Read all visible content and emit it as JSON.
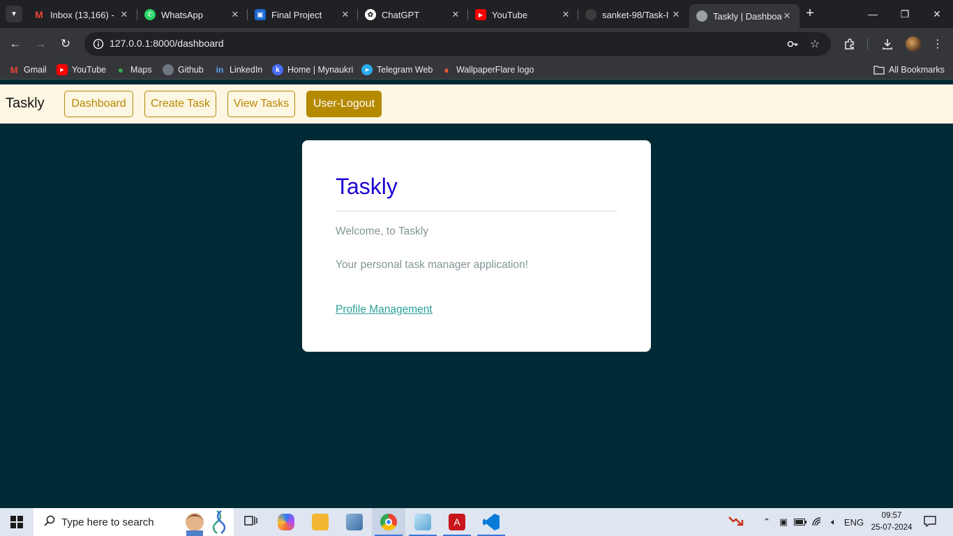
{
  "browser": {
    "tabs": [
      {
        "title": "Inbox (13,166) -",
        "favicon": "gmail-icon",
        "color": "#ea4335"
      },
      {
        "title": "WhatsApp",
        "favicon": "whatsapp-icon",
        "color": "#25d366"
      },
      {
        "title": "Final Project",
        "favicon": "classroom-icon",
        "color": "#1967d2"
      },
      {
        "title": "ChatGPT",
        "favicon": "chatgpt-icon",
        "color": "#ffffff"
      },
      {
        "title": "YouTube",
        "favicon": "youtube-icon",
        "color": "#ff0000"
      },
      {
        "title": "sanket-98/Task-I",
        "favicon": "github-icon",
        "color": "#3c3c3c"
      },
      {
        "title": "Taskly | Dashboa",
        "favicon": "globe-icon",
        "color": "#9aa0a6",
        "active": true
      }
    ],
    "url": "127.0.0.1:8000/dashboard",
    "bookmarks": [
      {
        "label": "Gmail",
        "icon": "gmail-icon"
      },
      {
        "label": "YouTube",
        "icon": "youtube-icon"
      },
      {
        "label": "Maps",
        "icon": "maps-icon"
      },
      {
        "label": "Github",
        "icon": "github-icon"
      },
      {
        "label": "LinkedIn",
        "icon": "linkedin-icon"
      },
      {
        "label": "Home | Mynaukri",
        "icon": "naukri-icon"
      },
      {
        "label": "Telegram Web",
        "icon": "telegram-icon"
      },
      {
        "label": "WallpaperFlare logo",
        "icon": "flame-icon"
      }
    ],
    "all_bookmarks": "All Bookmarks"
  },
  "app": {
    "brand": "Taskly",
    "nav": {
      "dashboard": "Dashboard",
      "create_task": "Create Task",
      "view_tasks": "View Tasks",
      "logout": "User-Logout"
    },
    "card": {
      "title": "Taskly",
      "welcome": "Welcome, to Taskly",
      "tagline": "Your personal task manager application!",
      "profile_link": "Profile Management"
    }
  },
  "taskbar": {
    "search_placeholder": "Type here to search",
    "language": "ENG",
    "time": "09:57",
    "date": "25-07-2024"
  },
  "colors": {
    "page_bg": "#002b36",
    "navbar_bg": "#fdf6e3",
    "accent": "#b58900",
    "title": "#1a00d4",
    "link": "#2aa198"
  }
}
